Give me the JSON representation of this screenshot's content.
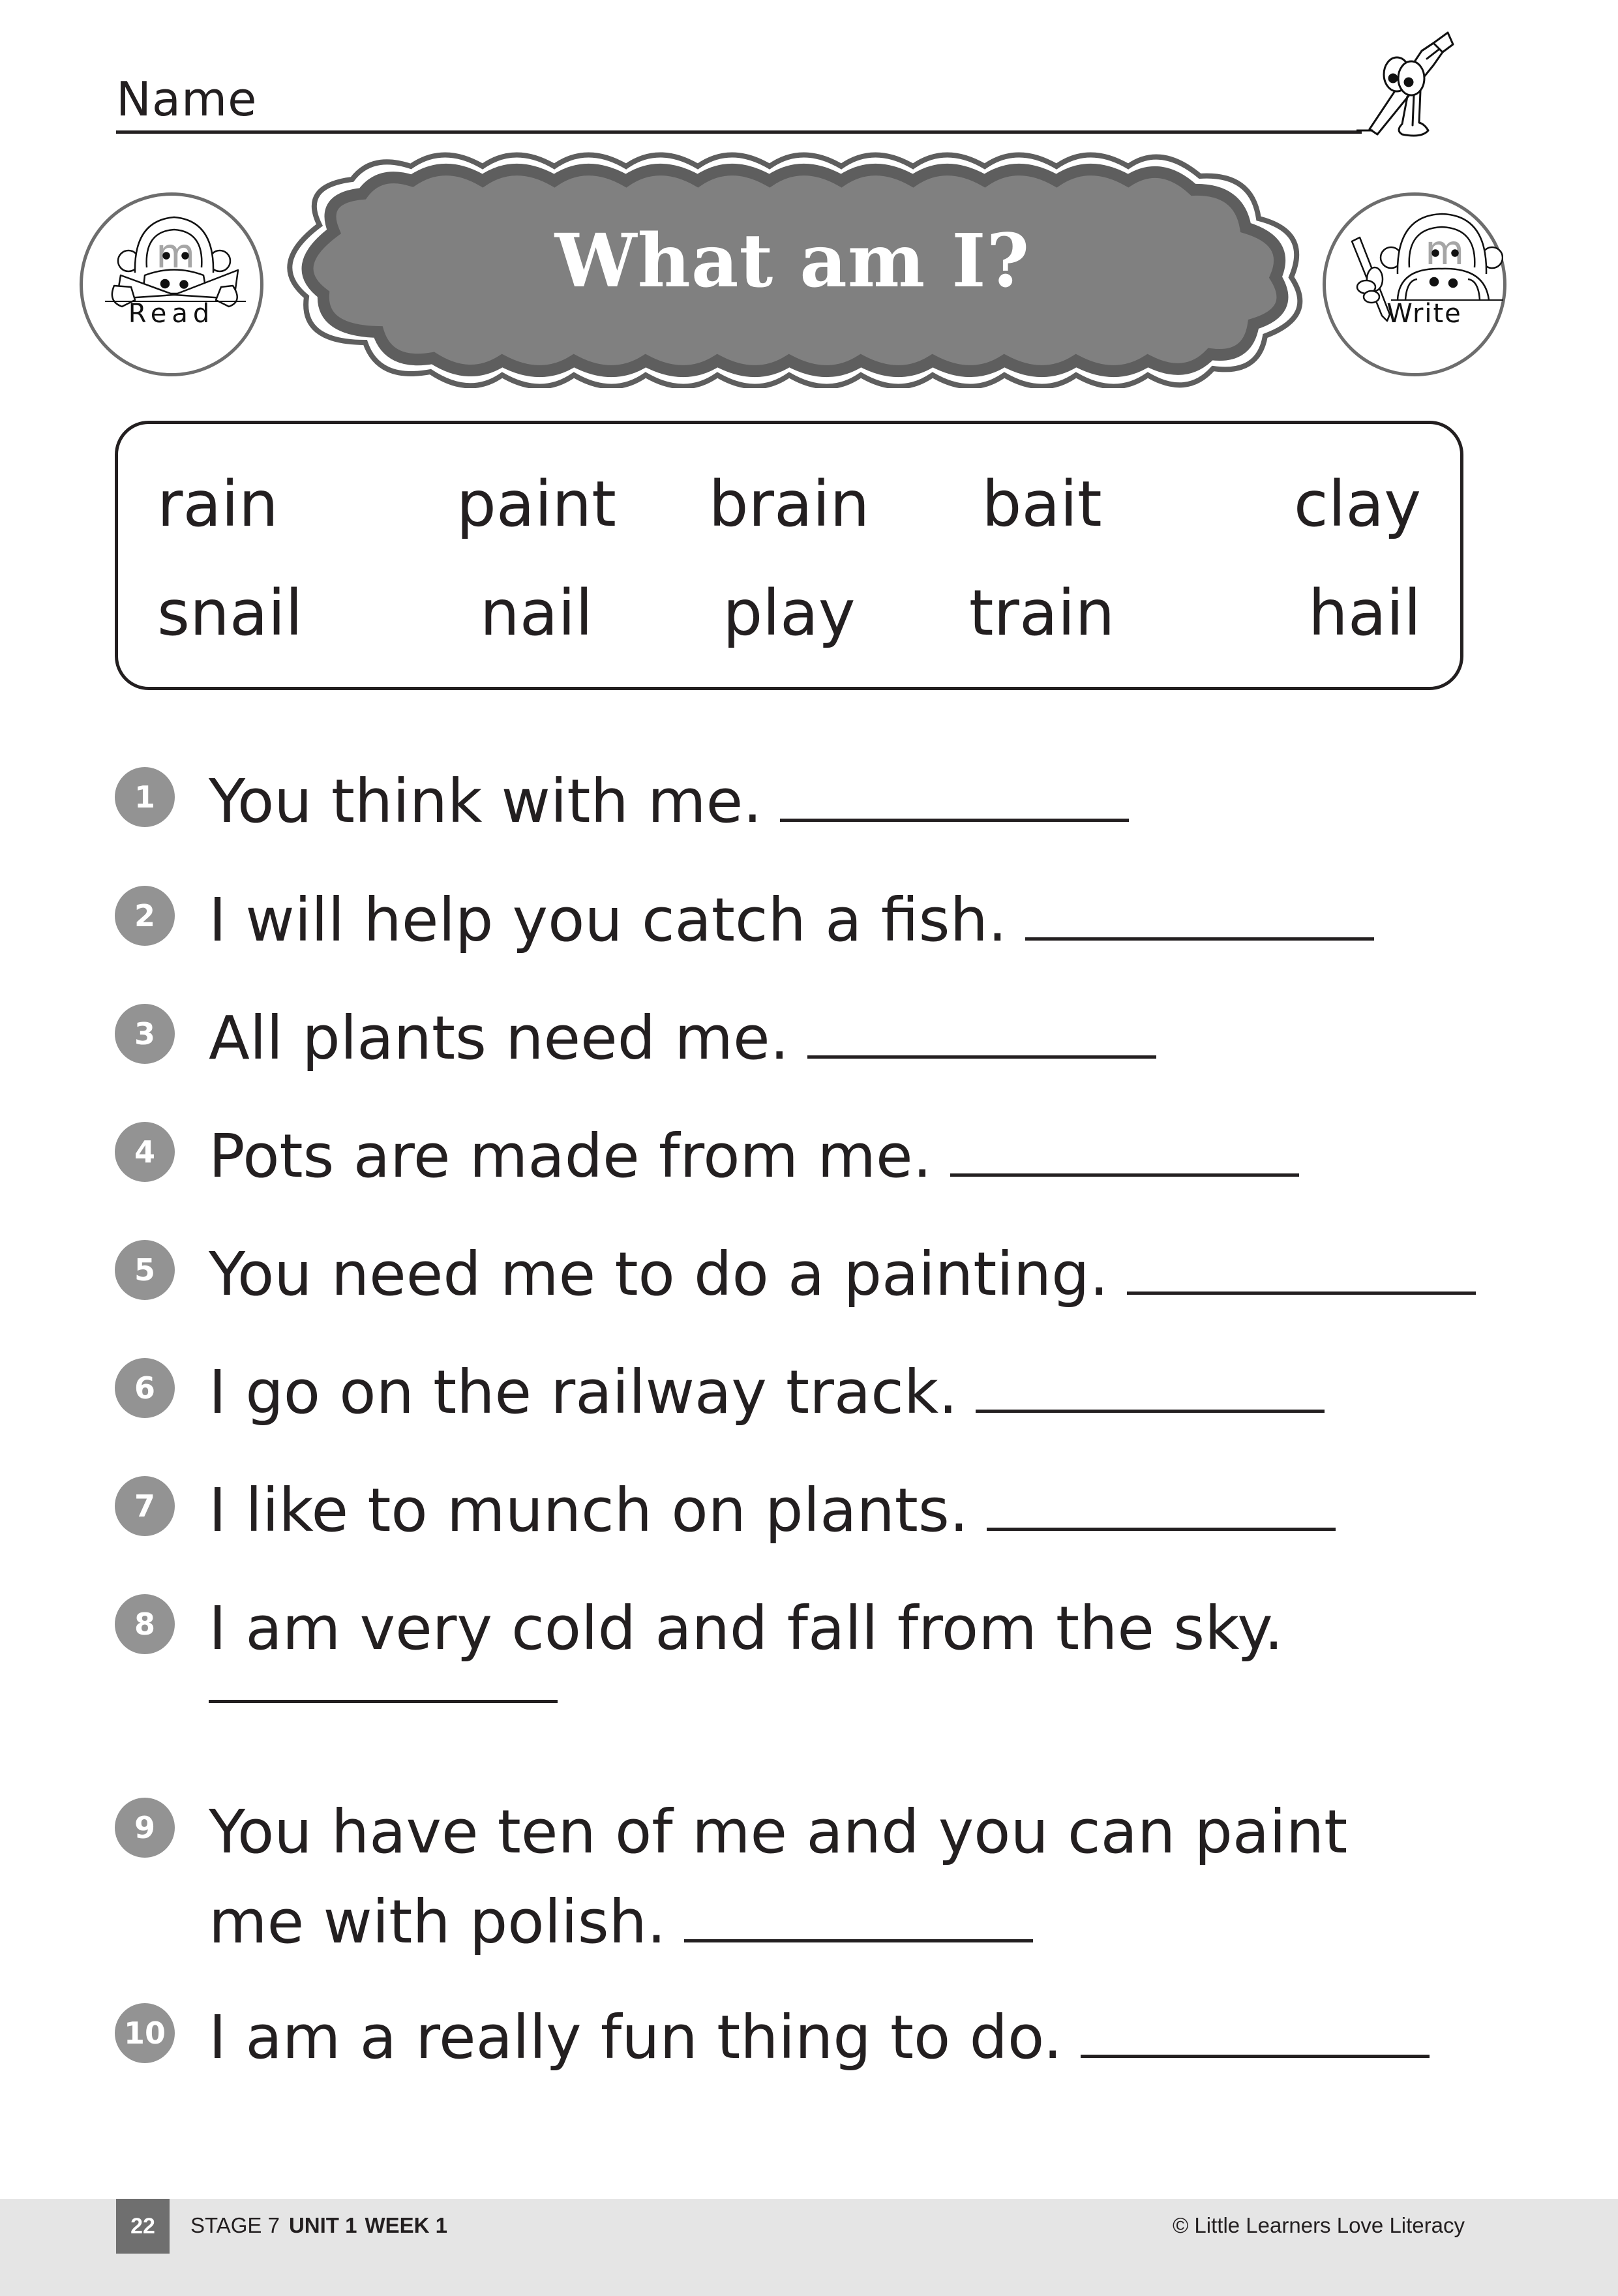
{
  "header": {
    "name_label": "Name",
    "title": "What am I?",
    "badges": {
      "read_label": "Read",
      "write_label": "Write"
    }
  },
  "word_bank": {
    "rows": [
      [
        "rain",
        "paint",
        "brain",
        "bait",
        "clay"
      ],
      [
        "snail",
        "nail",
        "play",
        "train",
        "hail"
      ]
    ]
  },
  "questions": [
    {
      "number": "1",
      "text": "You think with me.",
      "answer": ""
    },
    {
      "number": "2",
      "text": "I will help you catch a fish.",
      "answer": ""
    },
    {
      "number": "3",
      "text": "All plants need me.",
      "answer": ""
    },
    {
      "number": "4",
      "text": "Pots are made from me.",
      "answer": ""
    },
    {
      "number": "5",
      "text": "You need me to do a painting.",
      "answer": ""
    },
    {
      "number": "6",
      "text": "I go on the railway track.",
      "answer": ""
    },
    {
      "number": "7",
      "text": "I like to munch on plants.",
      "answer": ""
    },
    {
      "number": "8",
      "text": "I am very cold and fall from the sky.",
      "answer": ""
    },
    {
      "number": "9",
      "text_line1": "You have ten of me and you can paint",
      "text_line2": "me with polish.",
      "answer": ""
    },
    {
      "number": "10",
      "text": "I am a really fun thing to do.",
      "answer": ""
    }
  ],
  "footer": {
    "page_number": "22",
    "stage": "STAGE 7",
    "unit": "UNIT 1",
    "week": "WEEK 1",
    "copyright": "© Little Learners Love Literacy"
  },
  "colors": {
    "text": "#231f20",
    "banner_fill": "#808080",
    "banner_outline": "#5e5e5e",
    "number_circle": "#939393",
    "footer_bg": "#e5e5e5",
    "page_number_bg": "#6f6f6f",
    "mascot_letter": "#a6a6a6"
  }
}
